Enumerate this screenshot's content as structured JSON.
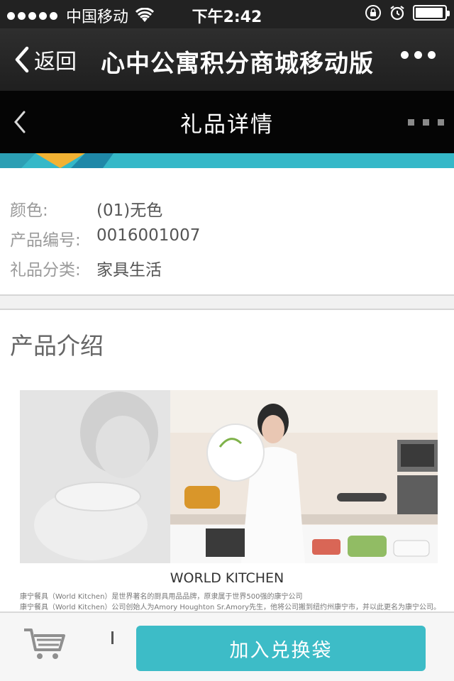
{
  "status_bar": {
    "carrier": "中国移动",
    "time": "下午2:42",
    "battery_level": 0.95
  },
  "nav_bar": {
    "back_label": "返回",
    "title": "心中公寓积分商城移动版"
  },
  "page_header": {
    "title": "礼品详情"
  },
  "info": {
    "rows": [
      {
        "label": "颜色:",
        "value": "(01)无色"
      },
      {
        "label": "产品编号:",
        "value": "0016001007"
      },
      {
        "label": "礼品分类:",
        "value": "家具生活"
      }
    ]
  },
  "section": {
    "title": "产品介绍"
  },
  "product": {
    "brand_title": "WORLD KITCHEN",
    "desc_lines": [
      "康宁餐具（World Kitchen）是世界著名的厨具用品品牌，原隶属于世界500强的康宁公司",
      "康宁餐具（World Kitchen）公司创始人为Amory Houghton Sr.Amory先生，他将公司搬到纽约州康宁市，并以此更名为康宁公司。"
    ]
  },
  "bottom_bar": {
    "add_button_label": "加入兑换袋"
  },
  "colors": {
    "accent": "#3dbcc7",
    "banner": "#35b8c8",
    "nav_bg": "#2a2a2a",
    "header_bg": "#050505"
  },
  "icons": [
    "wifi-icon",
    "orientation-lock-icon",
    "alarm-icon",
    "battery-icon",
    "back-chevron-icon",
    "more-icon",
    "cart-icon"
  ]
}
